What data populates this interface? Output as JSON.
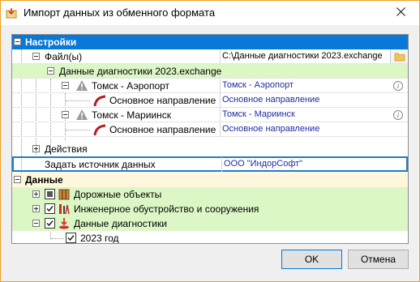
{
  "window": {
    "title": "Импорт данных из обменного формата",
    "close_glyph": "✕",
    "icon": "import-icon"
  },
  "tree": {
    "settings": {
      "label": "Настройки",
      "expanded": true
    },
    "files": {
      "label": "Файл(ы)",
      "value": "C:\\Данные диагностики 2023.exchange"
    },
    "exchange_file": {
      "label": "Данные диагностики 2023.exchange"
    },
    "tomsk_airport": {
      "label": "Томск - Аэропорт",
      "value": "Томск - Аэропорт",
      "info": "i"
    },
    "tomsk_airport_dir": {
      "label": "Основное направление",
      "value": "Основное направление"
    },
    "tomsk_mariinsk": {
      "label": "Томск - Мариинск",
      "value": "Томск - Мариинск",
      "info": "i"
    },
    "tomsk_mariinsk_dir": {
      "label": "Основное направление",
      "value": "Основное направление"
    },
    "actions": {
      "label": "Действия"
    },
    "data_source": {
      "label": "Задать источник данных",
      "value": "ООО \"ИндорСофт\""
    },
    "data": {
      "label": "Данные",
      "expanded": true
    },
    "road_objects": {
      "label": "Дорожные объекты",
      "checked": "partial"
    },
    "engineering": {
      "label": "Инженерное обустройство и сооружения",
      "checked": true
    },
    "diagnostics": {
      "label": "Данные диагностики",
      "checked": true
    },
    "year_2023": {
      "label": "2023 год",
      "checked": true
    }
  },
  "buttons": {
    "ok": "OK",
    "cancel": "Отмена"
  },
  "colors": {
    "selection": "#0a78d7",
    "green_row": "#dcf6c6",
    "yellow_row": "#fff8dc",
    "value_blue": "#1f2ea0",
    "focus_border": "#1f7cc4",
    "window_border": "#f0a020"
  }
}
